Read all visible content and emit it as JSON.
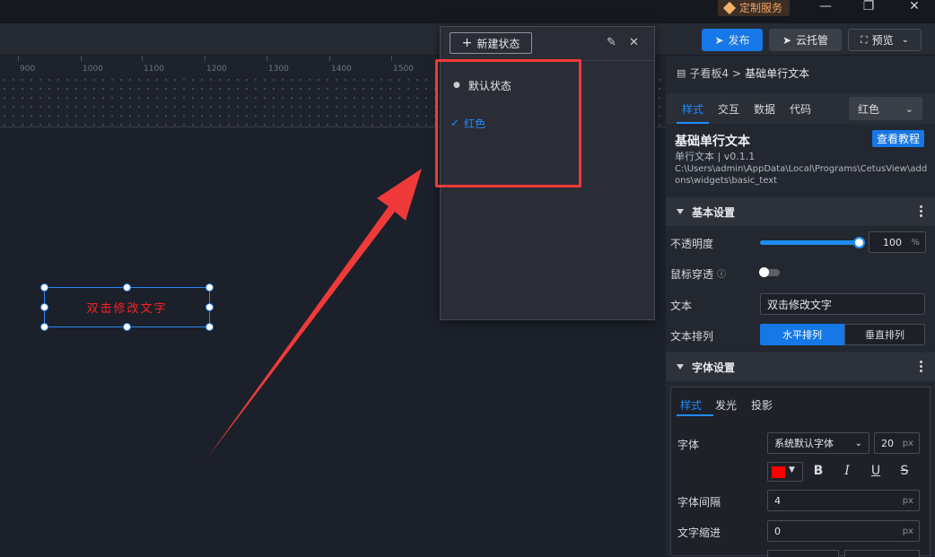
{
  "titlebar": {
    "service_label": "定制服务"
  },
  "toolbar": {
    "publish_label": "发布",
    "cloud_label": "云托管",
    "preview_label": "预览"
  },
  "ruler": {
    "labels": [
      "900",
      "1000",
      "1100",
      "1200",
      "1300",
      "1400",
      "1500"
    ]
  },
  "canvas": {
    "widget_text": "双击修改文字"
  },
  "state_panel": {
    "new_state_label": "新建状态",
    "items": [
      {
        "label": "默认状态",
        "selected": false
      },
      {
        "label": "红色",
        "selected": true
      }
    ]
  },
  "right_panel": {
    "breadcrumb": {
      "parent": "子看板4",
      "separator": ">",
      "current": "基础单行文本"
    },
    "tabs": [
      "样式",
      "交互",
      "数据",
      "代码"
    ],
    "active_tab": "样式",
    "state_select": "红色",
    "widget": {
      "title": "基础单行文本",
      "version": "单行文本 | v0.1.1",
      "path": "C:\\Users\\admin\\AppData\\Local\\Programs\\CetusView\\addons\\widgets\\basic_text",
      "tutorial_label": "查看教程"
    },
    "basic": {
      "title": "基本设置",
      "opacity_label": "不透明度",
      "opacity_value": "100",
      "opacity_unit": "%",
      "opacity_fraction": 1.0,
      "mouse_through_label": "鼠标穿透",
      "text_label": "文本",
      "text_value": "双击修改文字",
      "arrangement_label": "文本排列",
      "horizontal_label": "水平排列",
      "vertical_label": "垂直排列"
    },
    "font": {
      "title": "字体设置",
      "tabs": [
        "样式",
        "发光",
        "投影"
      ],
      "font_label": "字体",
      "font_value": "系统默认字体",
      "size_value": "20",
      "size_unit": "px",
      "color": "#ff0000",
      "bold": "B",
      "italic": "I",
      "underline": "U",
      "strike": "S",
      "spacing_label": "字体间隔",
      "spacing_value": "4",
      "spacing_unit": "px",
      "indent_label": "文字缩进",
      "indent_value": "0",
      "indent_unit": "px"
    }
  },
  "colors": {
    "accent": "#1677e6",
    "annotation": "#f03a3a",
    "widget_text": "#ff2020"
  }
}
